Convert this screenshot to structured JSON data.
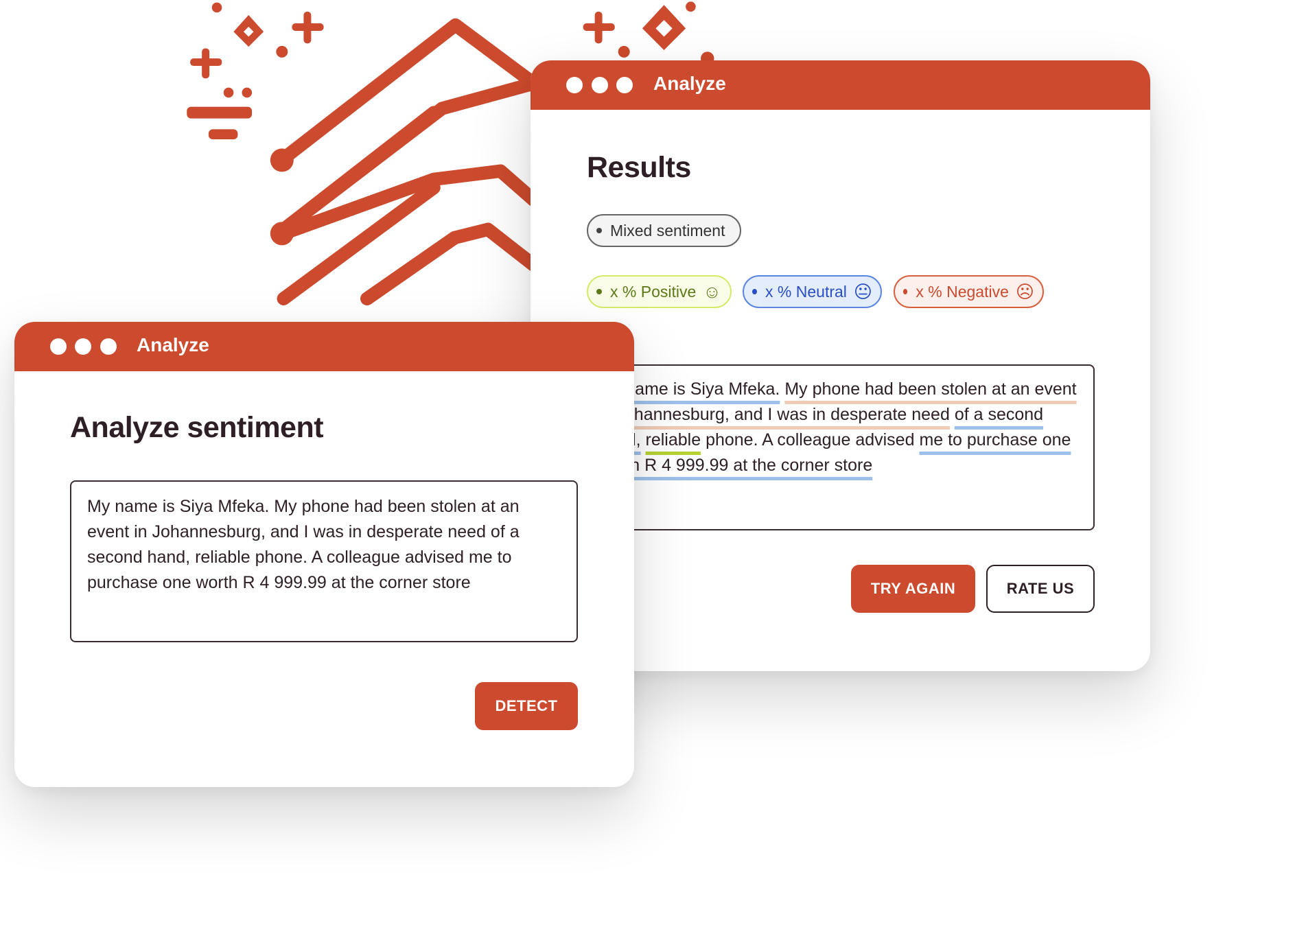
{
  "colors": {
    "brand": "#cc4a2d",
    "text": "#2e1f27",
    "positive": "#b5d334",
    "neutral": "#9dc0ea",
    "negative": "#f0cbb5"
  },
  "results_window": {
    "title": "Analyze",
    "heading": "Results",
    "overall_badge": "Mixed sentiment",
    "badges": [
      {
        "label": "x % Positive",
        "icon": "smile-icon"
      },
      {
        "label": "x % Neutral",
        "icon": "neutral-face-icon"
      },
      {
        "label": "x % Negative",
        "icon": "frown-icon"
      }
    ],
    "segments": [
      {
        "text": "My name is Siya Mfeka.",
        "sentiment": "neutral"
      },
      {
        "text": " ",
        "sentiment": "none"
      },
      {
        "text": "My phone had been stolen at an event in Johannesburg, and I was in desperate need",
        "sentiment": "negative"
      },
      {
        "text": " ",
        "sentiment": "none"
      },
      {
        "text": "of a second hand,",
        "sentiment": "neutral"
      },
      {
        "text": " ",
        "sentiment": "none"
      },
      {
        "text": "reliable",
        "sentiment": "positive"
      },
      {
        "text": " phone. A colleague advised ",
        "sentiment": "none"
      },
      {
        "text": "me to purchase one worth R 4 999.99 at the corner store",
        "sentiment": "neutral"
      }
    ],
    "try_again_label": "TRY AGAIN",
    "rate_us_label": "RATE US"
  },
  "input_window": {
    "title": "Analyze",
    "heading": "Analyze sentiment",
    "input_text": "My name is Siya Mfeka. My phone had been stolen at an event in Johannesburg, and I was in desperate need of a second hand, reliable phone. A colleague advised me to purchase one worth R 4 999.99 at the corner store",
    "detect_label": "DETECT"
  }
}
